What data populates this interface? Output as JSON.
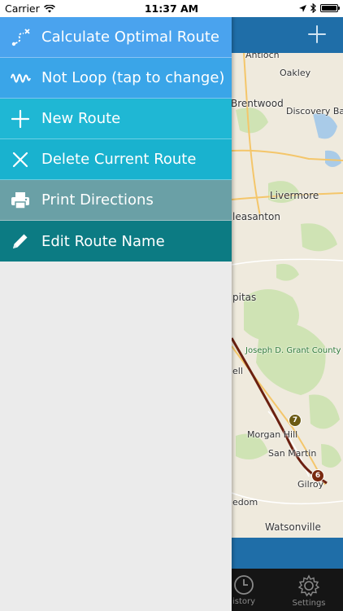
{
  "status_bar": {
    "carrier": "Carrier",
    "time": "11:37 AM"
  },
  "menu": {
    "items": [
      {
        "label": "Calculate Optimal Route",
        "icon": "route-optimize-icon",
        "color": "#4aa3ee"
      },
      {
        "label": "Not Loop (tap to change)",
        "icon": "waveform-icon",
        "color": "#3aa5e8"
      },
      {
        "label": "New Route",
        "icon": "plus-icon",
        "color": "#1fb7d4"
      },
      {
        "label": "Delete Current Route",
        "icon": "close-icon",
        "color": "#19b2cf"
      },
      {
        "label": "Print Directions",
        "icon": "printer-icon",
        "color": "#6aa0a6"
      },
      {
        "label": "Edit Route Name",
        "icon": "pencil-icon",
        "color": "#0c7b83"
      }
    ]
  },
  "map": {
    "places": {
      "antioch": "Antioch",
      "oakley": "Oakley",
      "brentwood": "Brentwood",
      "discovery_bay": "Discovery Bay",
      "livermore": "Livermore",
      "pleasanton": "leasanton",
      "milpitas": "pitas",
      "park": "Joseph D. Grant County Park",
      "morgan_hill": "Morgan Hill",
      "san_martin": "San Martin",
      "gilroy": "Gilroy",
      "watsonville": "Watsonville",
      "freedom": "edom",
      "campbell": "ell"
    },
    "markers": [
      {
        "number": "7",
        "color": "#6b5a12"
      },
      {
        "number": "6",
        "color": "#7a2a10"
      }
    ]
  },
  "tabs": {
    "history": "istory",
    "settings": "Settings"
  },
  "colors": {
    "header_blue": "#1f6ea8",
    "drawer_bg": "#ebebeb"
  }
}
